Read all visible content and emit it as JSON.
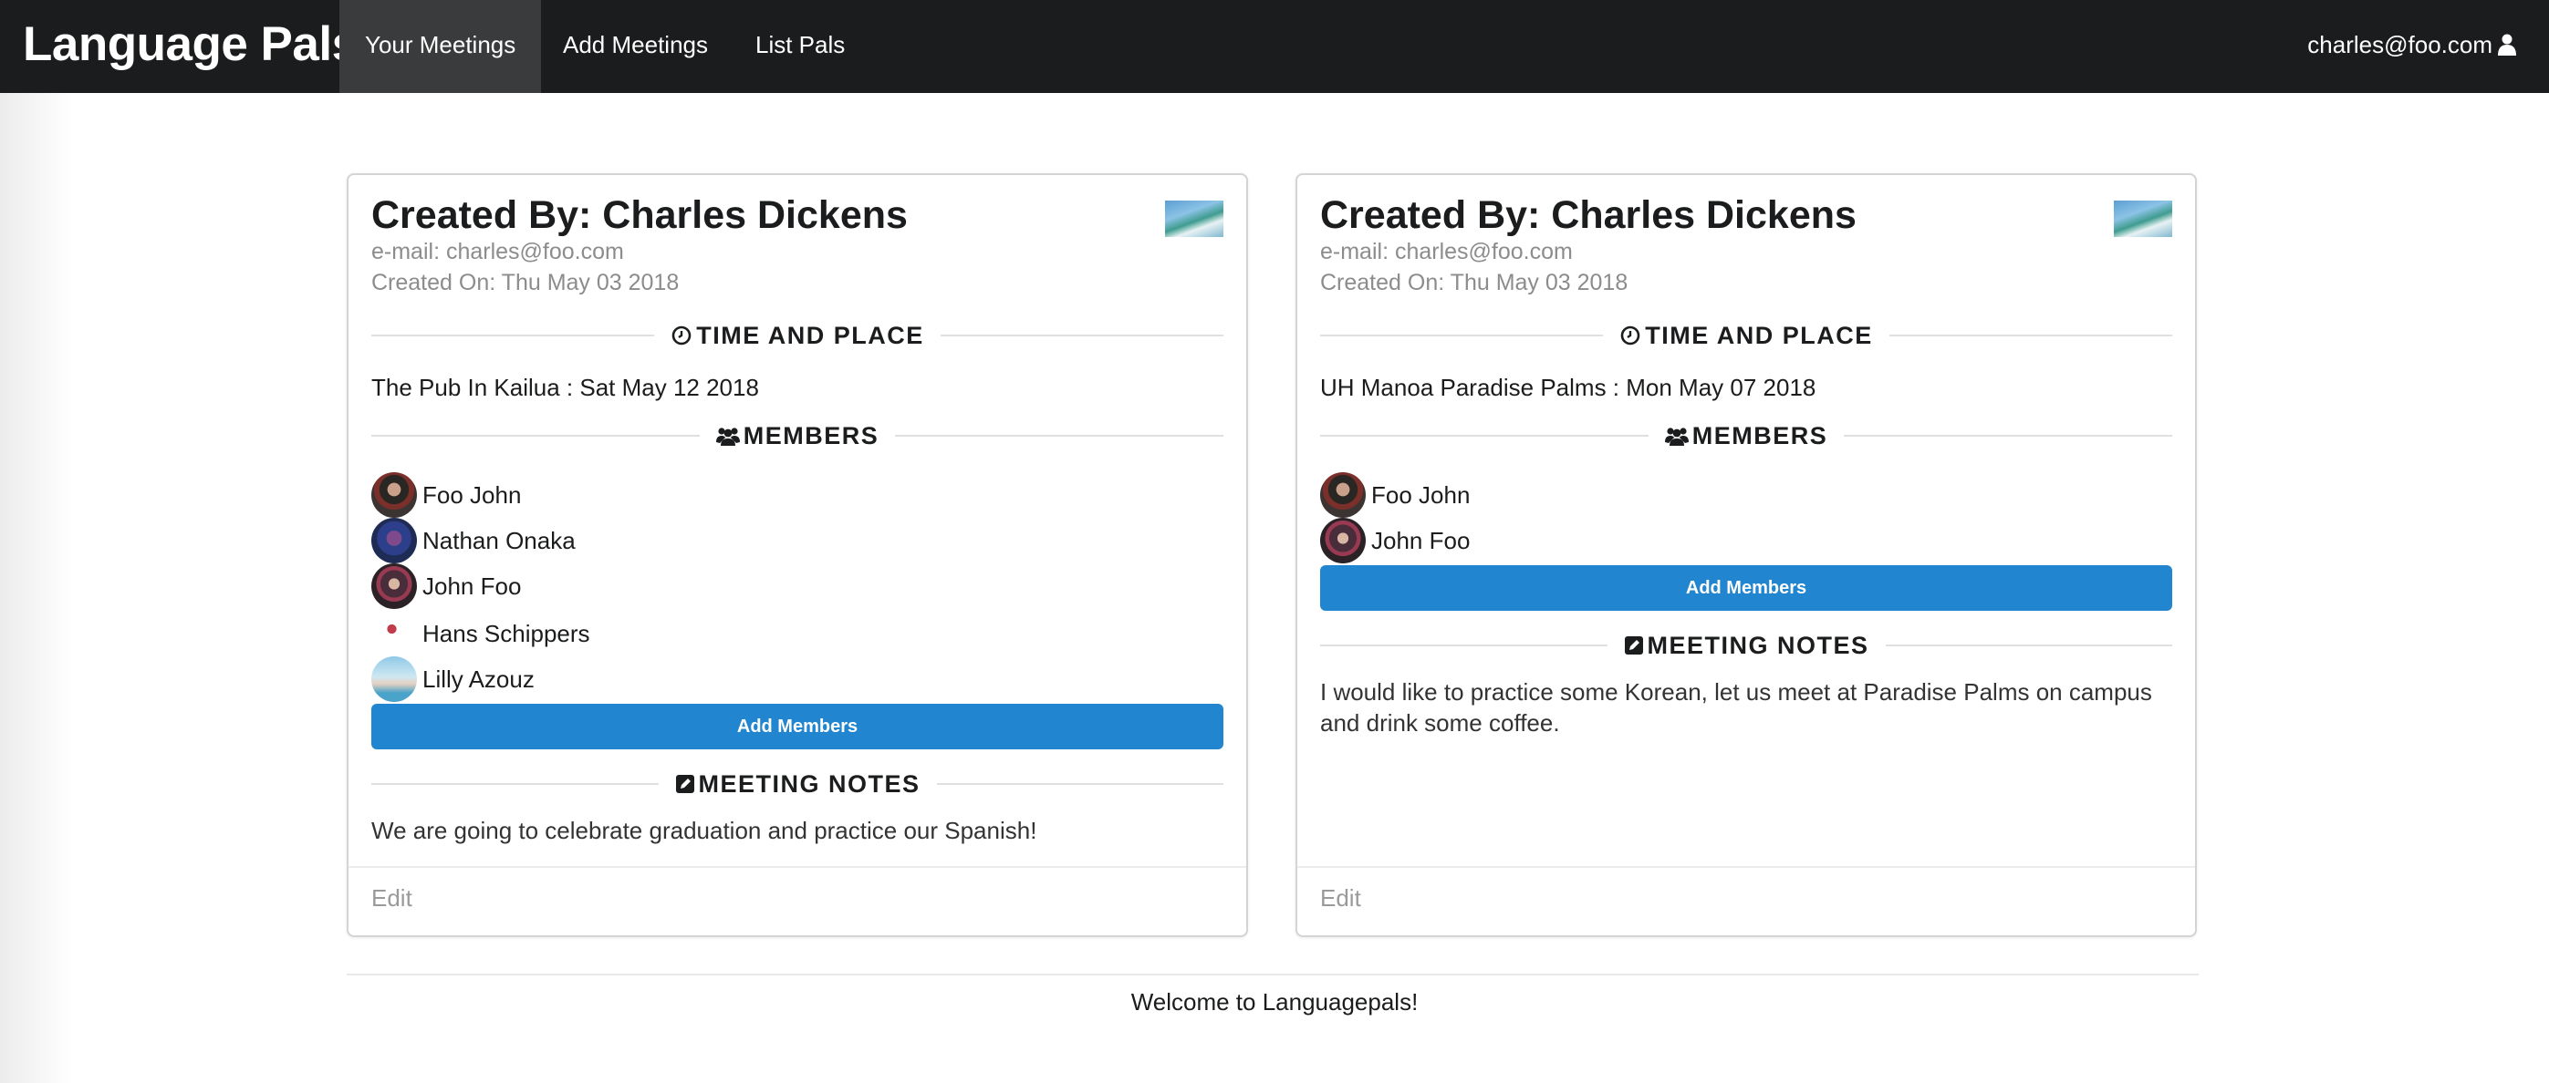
{
  "navbar": {
    "brand": "Language Pals",
    "items": [
      {
        "label": "Your Meetings",
        "active": true
      },
      {
        "label": "Add Meetings",
        "active": false
      },
      {
        "label": "List Pals",
        "active": false
      }
    ],
    "user": "charles@foo.com",
    "user_icon": "user-icon"
  },
  "cards": [
    {
      "header": "Created By: Charles Dickens",
      "email": "e-mail: charles@foo.com",
      "created": "Created On: Thu May 03 2018",
      "time_place_label": "TIME AND PLACE",
      "time_place": "The Pub In Kailua : Sat May 12 2018",
      "members_label": "MEMBERS",
      "members": [
        "Foo John",
        "Nathan Onaka",
        "John Foo",
        "Hans Schippers",
        "Lilly Azouz"
      ],
      "add_members": "Add Members",
      "notes_label": "MEETING NOTES",
      "notes": "We are going to celebrate graduation and practice our Spanish!",
      "edit": "Edit"
    },
    {
      "header": "Created By: Charles Dickens",
      "email": "e-mail: charles@foo.com",
      "created": "Created On: Thu May 03 2018",
      "time_place_label": "TIME AND PLACE",
      "time_place": "UH Manoa Paradise Palms : Mon May 07 2018",
      "members_label": "MEMBERS",
      "members": [
        "Foo John",
        "John Foo"
      ],
      "add_members": "Add Members",
      "notes_label": "MEETING NOTES",
      "notes": "I would like to practice some Korean, let us meet at Paradise Palms on campus and drink some coffee.",
      "edit": "Edit"
    }
  ],
  "footer": "Welcome to Languagepals!",
  "colors": {
    "navbar_bg": "#1b1c1d",
    "nav_active_bg": "#3a3b3c",
    "button_blue": "#2185d0"
  }
}
